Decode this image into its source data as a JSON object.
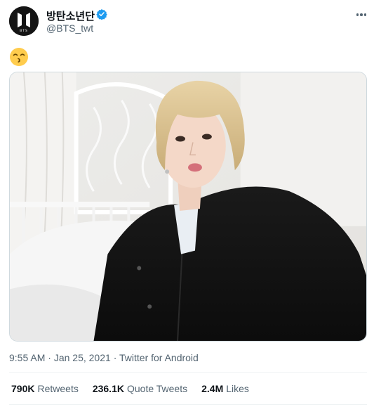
{
  "author": {
    "display_name": "방탄소년단",
    "handle": "@BTS_twt",
    "avatar_logo_text": "BTS",
    "verified": true
  },
  "tweet": {
    "text_emoji": "kissing-face-with-smiling-eyes",
    "photo_description_icon": "selfie-photo"
  },
  "meta": {
    "time": "9:55 AM",
    "separator": "·",
    "date": "Jan 25, 2021",
    "source": "Twitter for Android"
  },
  "stats": {
    "retweets_count": "790K",
    "retweets_label": "Retweets",
    "quotes_count": "236.1K",
    "quotes_label": "Quote Tweets",
    "likes_count": "2.4M",
    "likes_label": "Likes"
  },
  "colors": {
    "verified_blue": "#1d9bf0",
    "secondary_text": "#536471",
    "primary_text": "#0f1419",
    "divider": "#eff3f4"
  }
}
